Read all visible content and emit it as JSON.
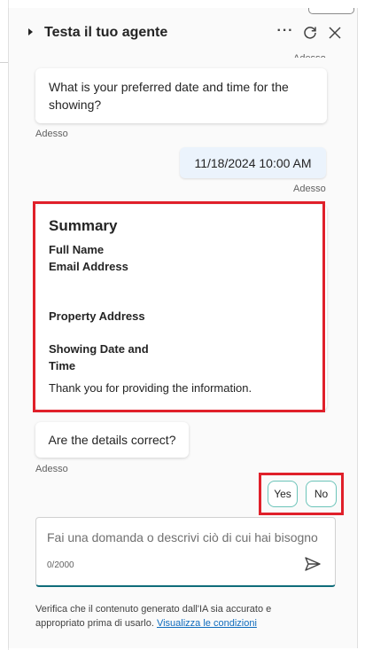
{
  "header": {
    "title": "Testa il tuo agente",
    "icons": [
      "caret-right-icon",
      "more-icon",
      "refresh-icon",
      "close-icon"
    ]
  },
  "messages": [
    {
      "role": "timestamp",
      "text": "Adesso"
    },
    {
      "role": "bot",
      "text": "What is your preferred date and time for the showing?",
      "time": "Adesso"
    },
    {
      "role": "user",
      "text": "11/18/2024 10:00 AM",
      "time": "Adesso"
    }
  ],
  "summary": {
    "title": "Summary",
    "fields": [
      "Full Name",
      "Email Address",
      "Property Address",
      "Showing Date and",
      "Time"
    ],
    "closing": "Thank you for providing the information."
  },
  "confirm": {
    "text": "Are the details correct?",
    "time": "Adesso"
  },
  "quick_replies": {
    "yes": "Yes",
    "no": "No"
  },
  "composer": {
    "placeholder": "Fai una domanda o descrivi ciò di cui hai bisogno",
    "counter": "0/2000"
  },
  "disclaimer": {
    "text": "Verifica che il contenuto generato dall'IA sia accurato e appropriato prima di usarlo.",
    "link": "Visualizza le condizioni"
  },
  "colors": {
    "accent": "#0f6c7a",
    "highlight": "#e0202a",
    "user_bubble": "#ebf3fc",
    "link": "#0f6cbd"
  }
}
